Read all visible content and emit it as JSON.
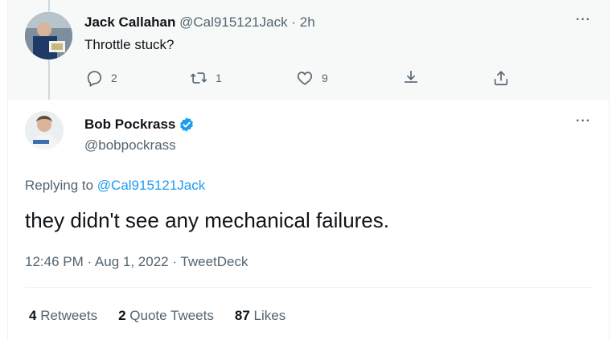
{
  "reply": {
    "name": "Jack Callahan",
    "handle": "@Cal915121Jack",
    "separator": "·",
    "time": "2h",
    "text": "Throttle stuck?",
    "actions": {
      "reply_count": "2",
      "retweet_count": "1",
      "like_count": "9"
    }
  },
  "tweet": {
    "name": "Bob Pockrass",
    "handle": "@bobpockrass",
    "replying_prefix": "Replying to ",
    "replying_to": "@Cal915121Jack",
    "text": "they didn't see any mechanical failures.",
    "meta": "12:46 PM · Aug 1, 2022 · TweetDeck",
    "stats": {
      "retweets_count": "4",
      "retweets_label": "Retweets",
      "quotes_count": "2",
      "quotes_label": "Quote Tweets",
      "likes_count": "87",
      "likes_label": "Likes"
    }
  },
  "more_label": "···",
  "colors": {
    "accent": "#1d9bf0",
    "secondary_text": "#536471",
    "primary_text": "#0f1419"
  },
  "icons": [
    "reply-icon",
    "retweet-icon",
    "like-icon",
    "bookmark-icon",
    "share-icon",
    "verified-icon",
    "more-icon"
  ]
}
